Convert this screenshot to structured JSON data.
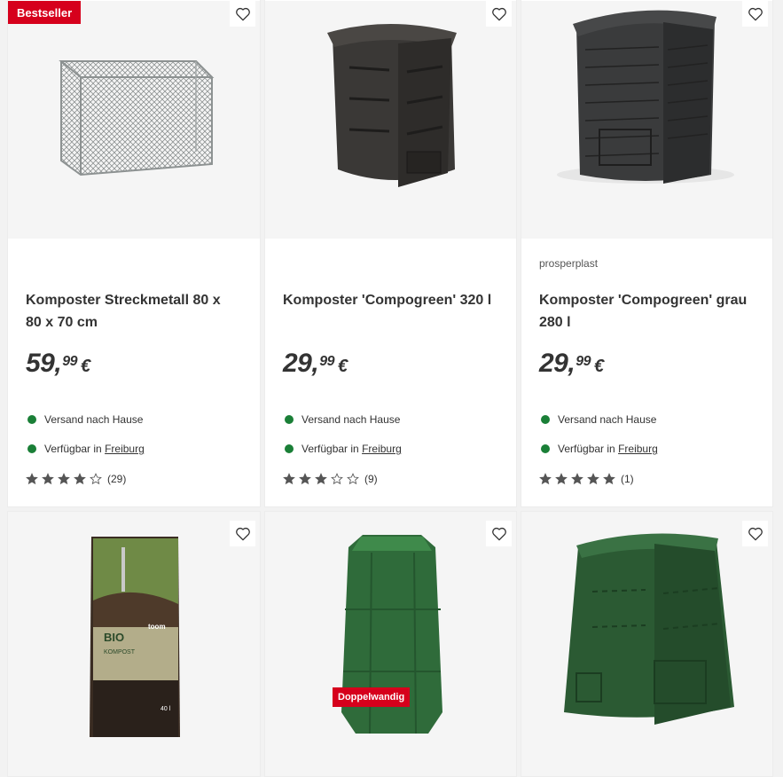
{
  "products": [
    {
      "badge": "Bestseller",
      "brand": "",
      "title": "Komposter Streckmetall 80 x 80 x 70 cm",
      "price_main": "59,",
      "price_cents": "99",
      "currency": "€",
      "availability": [
        "Versand nach Hause",
        "Verfügbar in"
      ],
      "store": "Freiburg",
      "rating": 4,
      "reviews": "(29)",
      "image": "wire-mesh-composter"
    },
    {
      "badge": "",
      "brand": "",
      "title": "Komposter 'Compogreen' 320 l",
      "price_main": "29,",
      "price_cents": "99",
      "currency": "€",
      "availability": [
        "Versand nach Hause",
        "Verfügbar in"
      ],
      "store": "Freiburg",
      "rating": 3,
      "reviews": "(9)",
      "image": "brown-composter"
    },
    {
      "badge": "",
      "brand": "prosperplast",
      "title": "Komposter 'Compogreen' grau 280 l",
      "price_main": "29,",
      "price_cents": "99",
      "currency": "€",
      "availability": [
        "Versand nach Hause",
        "Verfügbar in"
      ],
      "store": "Freiburg",
      "rating": 5,
      "reviews": "(1)",
      "image": "grey-composter"
    }
  ],
  "row2": [
    {
      "image": "bio-kompost-bag",
      "bag_brand": "toom",
      "bag_title": "BIO",
      "bag_subtitle": "KOMPOST",
      "bag_volume": "40 l"
    },
    {
      "image": "green-octagonal-composter",
      "badge": "Doppelwandig"
    },
    {
      "image": "green-square-composter"
    }
  ],
  "colors": {
    "badge": "#d6001c",
    "available_dot": "#1a7f37"
  }
}
